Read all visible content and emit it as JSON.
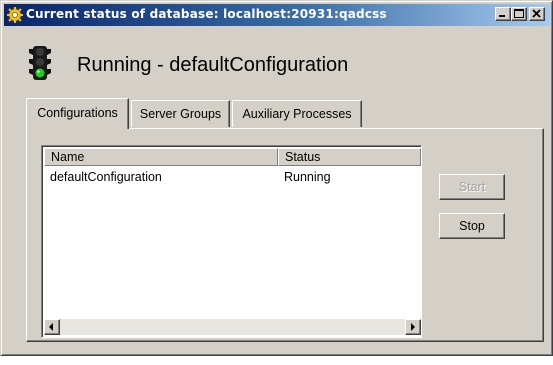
{
  "window": {
    "title": "Current status of database: localhost:20931:qadcss",
    "controls": [
      "minimize-icon",
      "maximize-icon",
      "close-icon"
    ]
  },
  "status": {
    "icon": "traffic-light-icon",
    "heading": "Running - defaultConfiguration"
  },
  "tabs": [
    {
      "label": "Configurations",
      "selected": true
    },
    {
      "label": "Server Groups",
      "selected": false
    },
    {
      "label": "Auxiliary Processes",
      "selected": false
    }
  ],
  "table": {
    "columns": [
      "Name",
      "Status"
    ],
    "rows": [
      {
        "name": "defaultConfiguration",
        "status": "Running"
      }
    ]
  },
  "buttons": {
    "start": {
      "label": "Start",
      "enabled": false
    },
    "stop": {
      "label": "Stop",
      "enabled": true
    }
  },
  "colors": {
    "title_bar_start": "#0a246a",
    "title_bar_end": "#a6caf0",
    "face": "#d4d0c8",
    "light_green": "#22cc22"
  }
}
